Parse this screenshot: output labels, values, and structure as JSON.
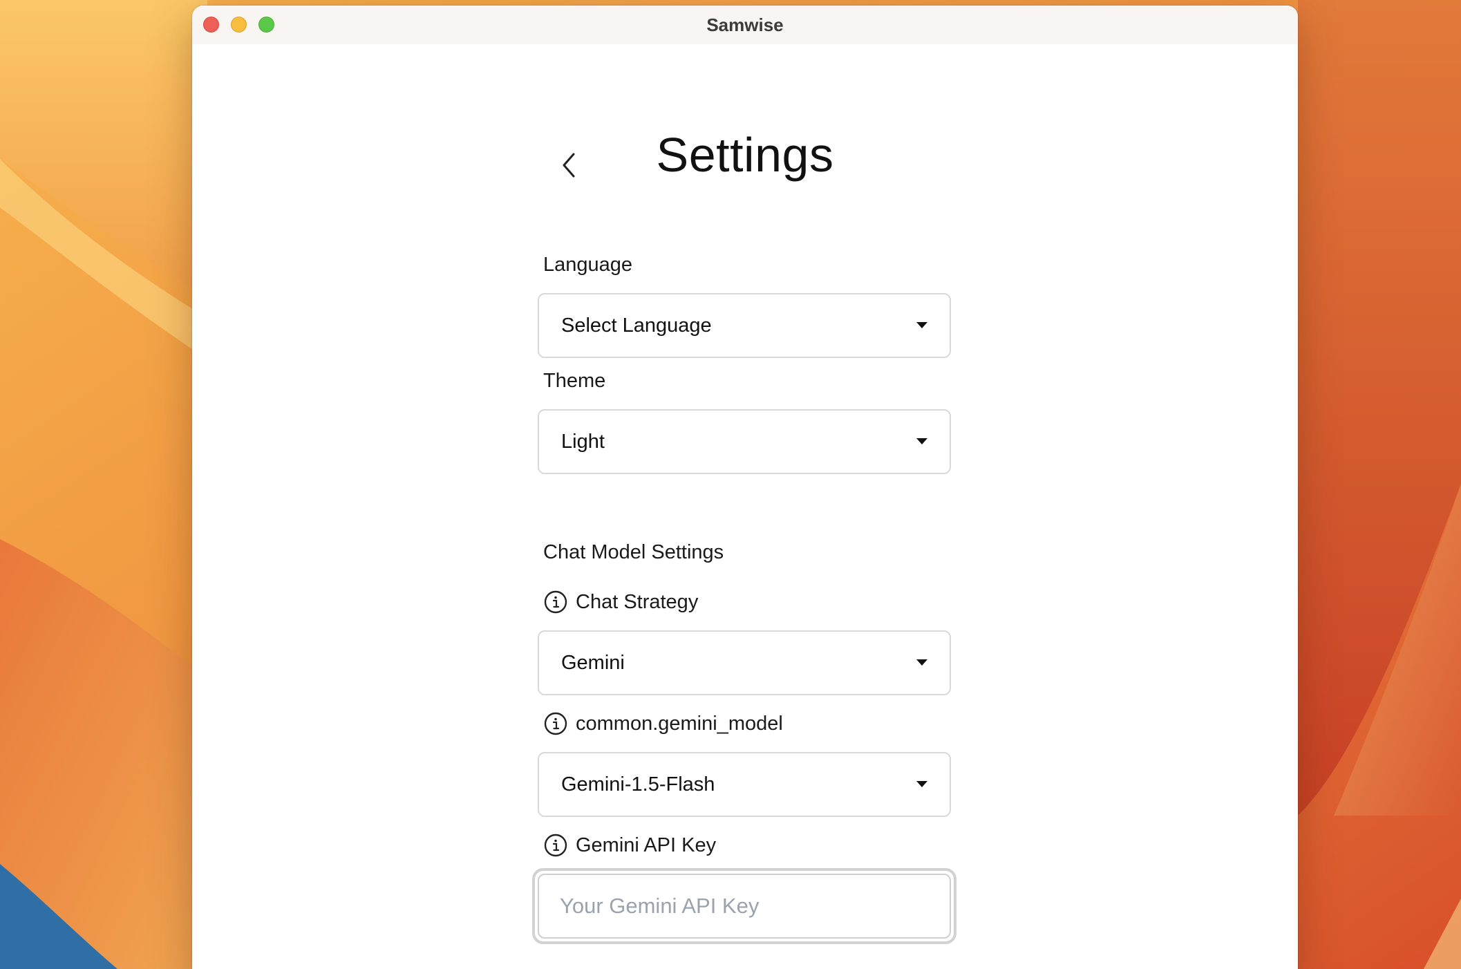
{
  "window": {
    "title": "Samwise"
  },
  "header": {
    "back_icon": "chevron-left-icon",
    "title": "Settings"
  },
  "language": {
    "label": "Language",
    "value": "Select Language"
  },
  "theme": {
    "label": "Theme",
    "value": "Light"
  },
  "chat_model": {
    "section_title": "Chat Model Settings",
    "strategy": {
      "label": "Chat Strategy",
      "value": "Gemini"
    },
    "model": {
      "label": "common.gemini_model",
      "value": "Gemini-1.5-Flash"
    },
    "api_key": {
      "label": "Gemini API Key",
      "value": "",
      "placeholder": "Your Gemini API Key"
    }
  },
  "colors": {
    "close": "#ee5f58",
    "minimize": "#f6bd3f",
    "maximize": "#5cc84a",
    "placeholder": "#9aa3ad"
  }
}
